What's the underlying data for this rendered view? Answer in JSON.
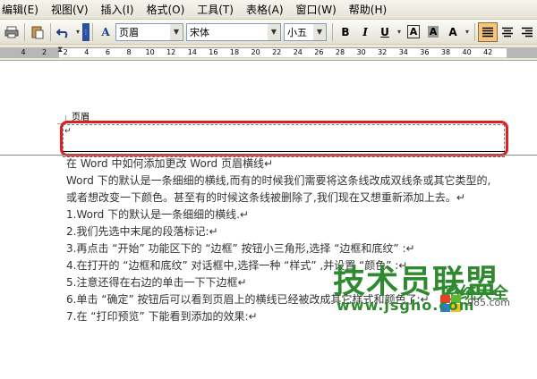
{
  "menu": [
    "编辑(E)",
    "视图(V)",
    "插入(I)",
    "格式(O)",
    "工具(T)",
    "表格(A)",
    "窗口(W)",
    "帮助(H)"
  ],
  "toolbar": {
    "style_value": "页眉",
    "font_value": "宋体",
    "size_value": "小五",
    "bold": "B",
    "italic": "I",
    "underline": "U",
    "font_color_letter": "A",
    "char_shading_letter": "A",
    "char_border_letter": "A",
    "style_icon_letter": "A"
  },
  "ruler": {
    "numbers": [
      "4",
      "2",
      "2",
      "4",
      "6",
      "8",
      "10",
      "12",
      "14",
      "16",
      "18",
      "20",
      "22",
      "24",
      "26",
      "28",
      "30",
      "32",
      "34",
      "36",
      "38",
      "40",
      "42"
    ]
  },
  "document": {
    "header_label": "页眉",
    "lines": [
      "在 Word 中如何添加更改 Word 页眉横线↵",
      "Word 下的默认是一条细细的横线,而有的时候我们需要将这条线改成双线条或其它类型的,",
      "或者想改变一下颜色。甚至有的时候这条线被删除了,我们现在又想重新添加上去。↵",
      "1.Word 下的默认是一条细细的横线.↵",
      "2.我们先选中末尾的段落标记:↵",
      "3.再点击 “开始” 功能区下的 “边框” 按钮小三角形,选择 “边框和底纹” :↵",
      "4.在打开的 “边框和底纹” 对话框中,选择一种 “样式” ,并设置 “颜色” :↵",
      "5.注意还得在右边的单击一下下边框↵",
      "6.单击 “确定” 按钮后可以看到页眉上的横线已经被改成其它样式和颜色了:↵",
      "7.在 “打印预览” 下能看到添加的效果:↵"
    ]
  },
  "watermark": {
    "main": "技术员联盟",
    "url": "www.jsgho.com",
    "sub": "系统大全",
    "site": "985.com"
  },
  "colors": {
    "highlight": "#e02020",
    "watermark": "#2f8a2f"
  }
}
